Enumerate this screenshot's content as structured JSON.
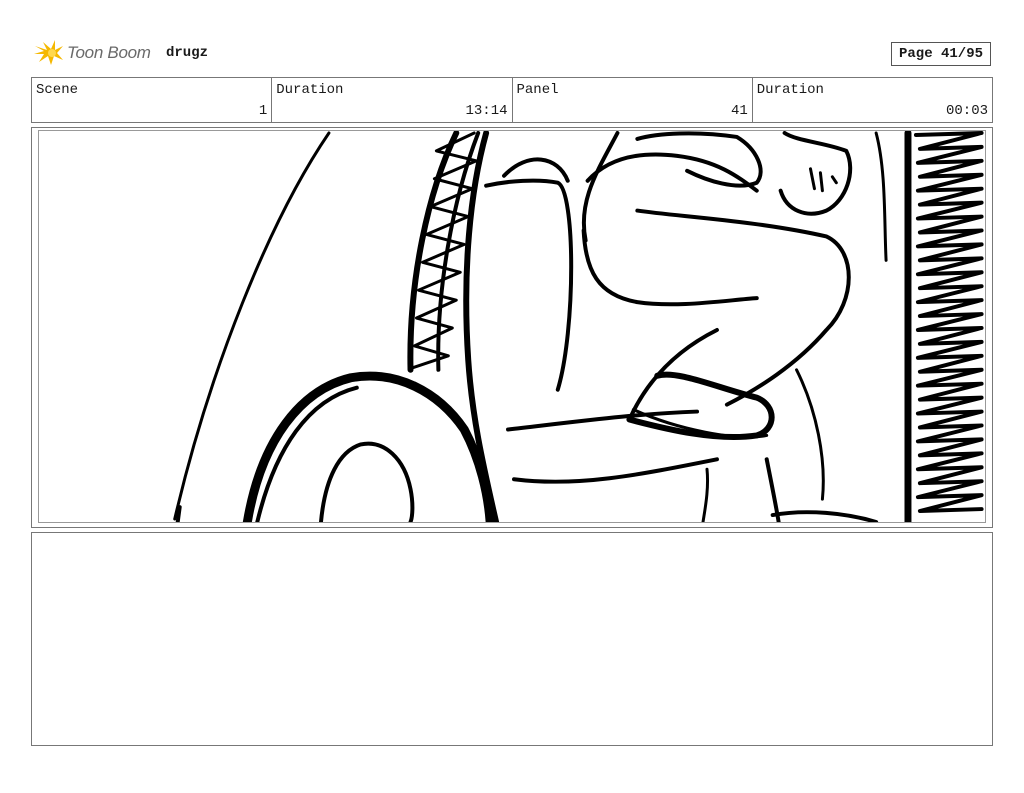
{
  "header": {
    "brand": "Toon Boom",
    "project": "drugz",
    "page": "Page 41/95"
  },
  "info": {
    "scene_label": "Scene",
    "scene_value": "1",
    "scene_duration_label": "Duration",
    "scene_duration_value": "13:14",
    "panel_label": "Panel",
    "panel_value": "41",
    "panel_duration_label": "Duration",
    "panel_duration_value": "00:03"
  },
  "icons": {
    "logo": "toon-boom-logo-icon"
  },
  "colors": {
    "logo_accent": "#f5b800",
    "ink": "#000000",
    "border": "#777777"
  }
}
